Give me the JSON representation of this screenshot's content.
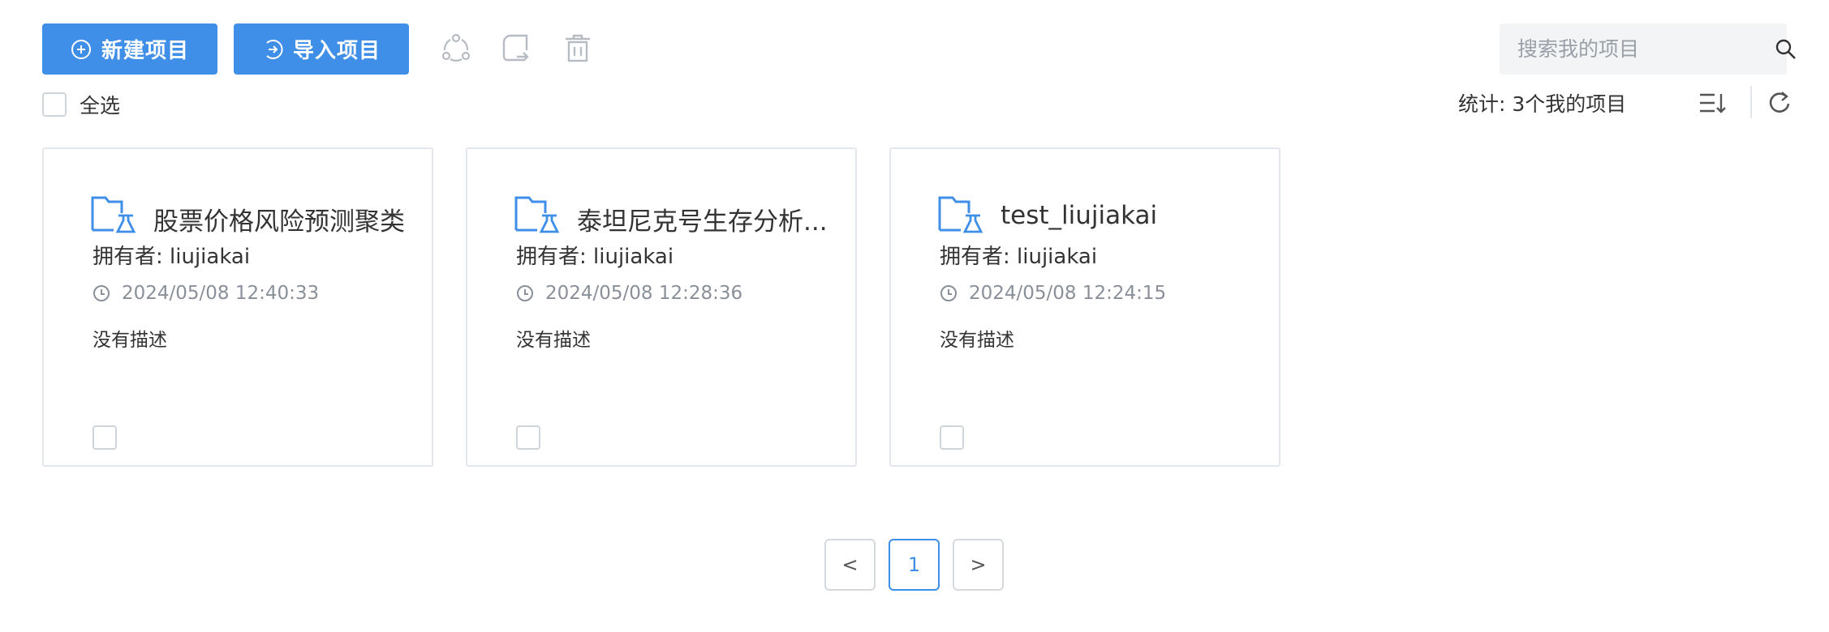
{
  "toolbar": {
    "new_project_label": "新建项目",
    "import_project_label": "导入项目",
    "icons": [
      "share-icon",
      "export-icon",
      "delete-icon"
    ]
  },
  "search": {
    "placeholder": "搜索我的项目",
    "icon": "search-icon"
  },
  "select_all_label": "全选",
  "stats_text": "统计: 3个我的项目",
  "projects": [
    {
      "title": "股票价格风险预测聚类",
      "owner": "拥有者: liujiakai",
      "time": "2024/05/08 12:40:33",
      "description": "没有描述"
    },
    {
      "title": "泰坦尼克号生存分析...",
      "owner": "拥有者: liujiakai",
      "time": "2024/05/08 12:28:36",
      "description": "没有描述"
    },
    {
      "title": "test_liujiakai",
      "owner": "拥有者: liujiakai",
      "time": "2024/05/08 12:24:15",
      "description": "没有描述"
    }
  ],
  "pagination": {
    "prev": "<",
    "current": "1",
    "next": ">"
  },
  "colors": {
    "primary": "#3f8ee8",
    "border": "#e3e6ea",
    "muted_text": "#8a9099"
  }
}
